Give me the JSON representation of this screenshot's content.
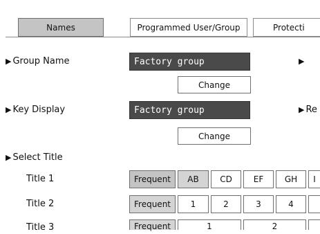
{
  "tabs": [
    {
      "label": "Names",
      "active": true
    },
    {
      "label": "Programmed User/Group",
      "active": false
    },
    {
      "label": "Protecti",
      "active": false
    }
  ],
  "group_name": {
    "label": "Group Name",
    "value": "Factory group",
    "change_label": "Change"
  },
  "key_display": {
    "label": "Key Display",
    "value": "Factory group",
    "change_label": "Change"
  },
  "right_labels": {
    "first": "",
    "second": "Re"
  },
  "select_title": {
    "label": "Select Title",
    "rows": [
      {
        "title": "Title 1",
        "keys": [
          "Frequent",
          "AB",
          "CD",
          "EF",
          "GH",
          "I"
        ]
      },
      {
        "title": "Title 2",
        "keys": [
          "Frequent",
          "1",
          "2",
          "3",
          "4",
          ""
        ]
      },
      {
        "title": "Title 3",
        "keys": [
          "Frequent",
          "1",
          "2"
        ]
      }
    ]
  },
  "colors": {
    "field_bg": "#4a4a4a",
    "selected_bg": "#c4c4c4",
    "border": "#6e6e6e"
  }
}
